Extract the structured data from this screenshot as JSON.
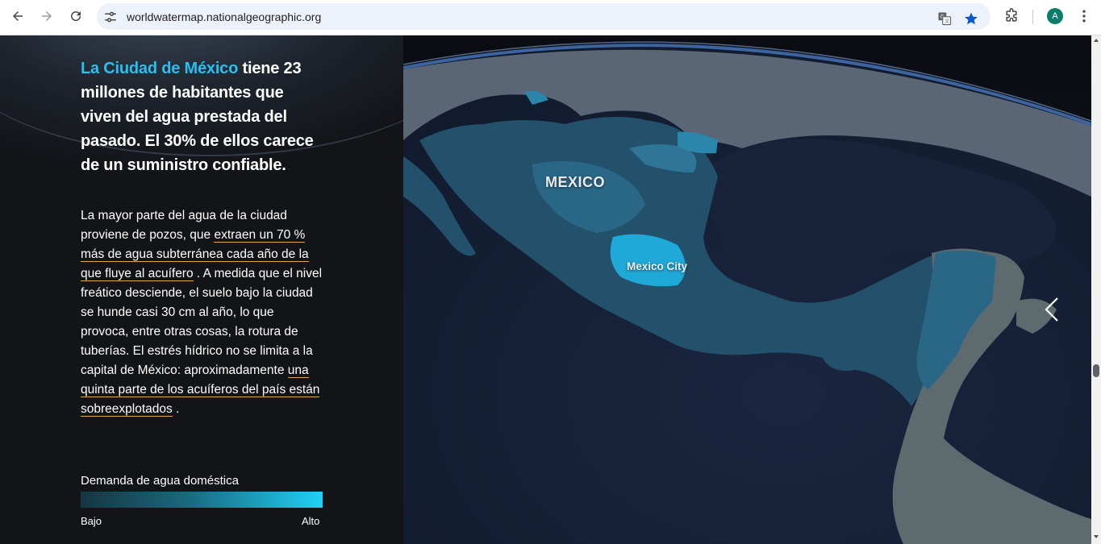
{
  "browser": {
    "url": "worldwatermap.nationalgeographic.org",
    "avatar_initial": "A"
  },
  "article": {
    "headline_highlight": "La Ciudad de México",
    "headline_rest": " tiene 23 millones de habitantes que viven del agua prestada del pasado. El 30% de ellos carece de un suministro confiable.",
    "p_part1": "La mayor parte del agua de la ciudad proviene de pozos, que ",
    "link1": "extraen un 70 % más de agua subterránea cada año de la que fluye al acuífero",
    "p_part2": " . A medida que el nivel freático desciende, el suelo bajo la ciudad se hunde casi 30 cm al año, lo que provoca, entre otras cosas, la rotura de tuberías. El estrés hídrico no se limita a la capital de México: aproximadamente ",
    "link2": "una quinta parte de los acuíferos del país están sobreexplotados",
    "p_part3": " ."
  },
  "legend": {
    "title": "Demanda de agua doméstica",
    "low": "Bajo",
    "high": "Alto",
    "color_low": "#16353f",
    "color_high": "#1fd0f7"
  },
  "map": {
    "country_label": "MEXICO",
    "city_label": "Mexico City"
  },
  "colors": {
    "accent": "#27c0f0",
    "link_underline": "#d9a93a"
  }
}
